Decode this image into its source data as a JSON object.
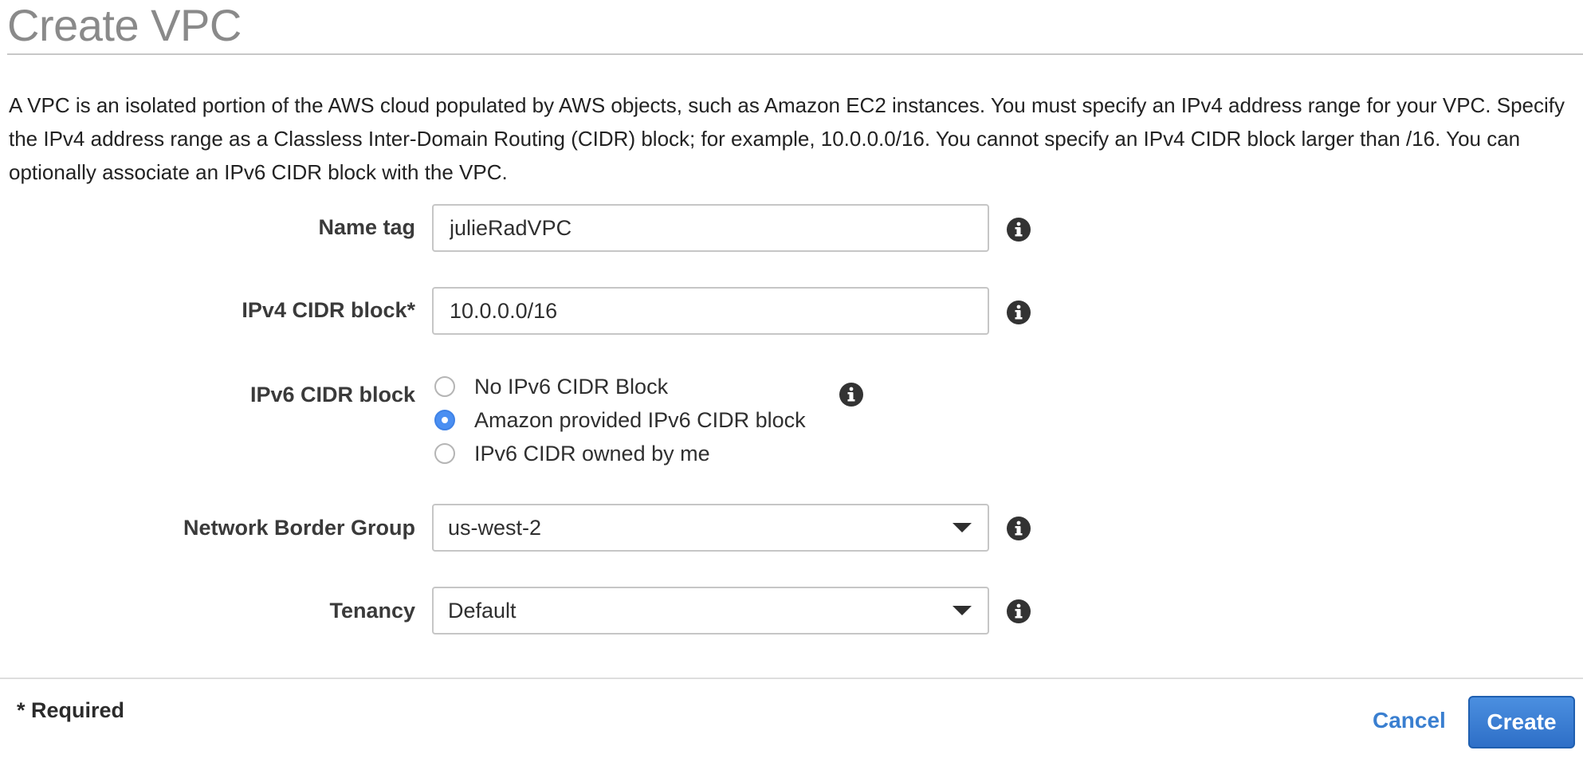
{
  "page": {
    "title": "Create VPC",
    "description": "A VPC is an isolated portion of the AWS cloud populated by AWS objects, such as Amazon EC2 instances. You must specify an IPv4 address range for your VPC. Specify the IPv4 address range as a Classless Inter-Domain Routing (CIDR) block; for example, 10.0.0.0/16. You cannot specify an IPv4 CIDR block larger than /16. You can optionally associate an IPv6 CIDR block with the VPC."
  },
  "form": {
    "name_tag": {
      "label": "Name tag",
      "value": "julieRadVPC"
    },
    "ipv4_cidr": {
      "label": "IPv4 CIDR block*",
      "value": "10.0.0.0/16"
    },
    "ipv6_cidr": {
      "label": "IPv6 CIDR block",
      "options": [
        {
          "label": "No IPv6 CIDR Block",
          "selected": false
        },
        {
          "label": "Amazon provided IPv6 CIDR block",
          "selected": true
        },
        {
          "label": "IPv6 CIDR owned by me",
          "selected": false
        }
      ]
    },
    "network_border_group": {
      "label": "Network Border Group",
      "value": "us-west-2"
    },
    "tenancy": {
      "label": "Tenancy",
      "value": "Default"
    }
  },
  "footer": {
    "required_note": "* Required",
    "cancel_label": "Cancel",
    "create_label": "Create"
  },
  "icons": {
    "info": "info-icon",
    "dropdown": "chevron-down-icon"
  },
  "colors": {
    "primary_button": "#3278d0",
    "link": "#3a7fd0",
    "radio_selected": "#4a8ff2"
  }
}
